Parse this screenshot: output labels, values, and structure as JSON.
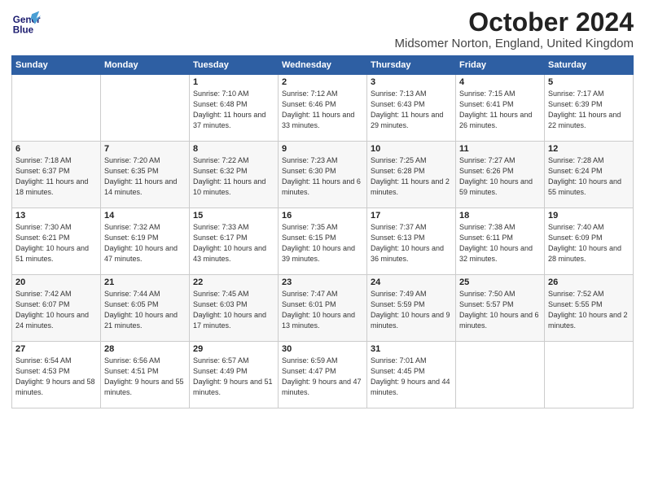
{
  "header": {
    "logo_line1": "General",
    "logo_line2": "Blue",
    "month_title": "October 2024",
    "location": "Midsomer Norton, England, United Kingdom"
  },
  "days_of_week": [
    "Sunday",
    "Monday",
    "Tuesday",
    "Wednesday",
    "Thursday",
    "Friday",
    "Saturday"
  ],
  "weeks": [
    [
      {
        "day": "",
        "sunrise": "",
        "sunset": "",
        "daylight": ""
      },
      {
        "day": "",
        "sunrise": "",
        "sunset": "",
        "daylight": ""
      },
      {
        "day": "1",
        "sunrise": "Sunrise: 7:10 AM",
        "sunset": "Sunset: 6:48 PM",
        "daylight": "Daylight: 11 hours and 37 minutes."
      },
      {
        "day": "2",
        "sunrise": "Sunrise: 7:12 AM",
        "sunset": "Sunset: 6:46 PM",
        "daylight": "Daylight: 11 hours and 33 minutes."
      },
      {
        "day": "3",
        "sunrise": "Sunrise: 7:13 AM",
        "sunset": "Sunset: 6:43 PM",
        "daylight": "Daylight: 11 hours and 29 minutes."
      },
      {
        "day": "4",
        "sunrise": "Sunrise: 7:15 AM",
        "sunset": "Sunset: 6:41 PM",
        "daylight": "Daylight: 11 hours and 26 minutes."
      },
      {
        "day": "5",
        "sunrise": "Sunrise: 7:17 AM",
        "sunset": "Sunset: 6:39 PM",
        "daylight": "Daylight: 11 hours and 22 minutes."
      }
    ],
    [
      {
        "day": "6",
        "sunrise": "Sunrise: 7:18 AM",
        "sunset": "Sunset: 6:37 PM",
        "daylight": "Daylight: 11 hours and 18 minutes."
      },
      {
        "day": "7",
        "sunrise": "Sunrise: 7:20 AM",
        "sunset": "Sunset: 6:35 PM",
        "daylight": "Daylight: 11 hours and 14 minutes."
      },
      {
        "day": "8",
        "sunrise": "Sunrise: 7:22 AM",
        "sunset": "Sunset: 6:32 PM",
        "daylight": "Daylight: 11 hours and 10 minutes."
      },
      {
        "day": "9",
        "sunrise": "Sunrise: 7:23 AM",
        "sunset": "Sunset: 6:30 PM",
        "daylight": "Daylight: 11 hours and 6 minutes."
      },
      {
        "day": "10",
        "sunrise": "Sunrise: 7:25 AM",
        "sunset": "Sunset: 6:28 PM",
        "daylight": "Daylight: 11 hours and 2 minutes."
      },
      {
        "day": "11",
        "sunrise": "Sunrise: 7:27 AM",
        "sunset": "Sunset: 6:26 PM",
        "daylight": "Daylight: 10 hours and 59 minutes."
      },
      {
        "day": "12",
        "sunrise": "Sunrise: 7:28 AM",
        "sunset": "Sunset: 6:24 PM",
        "daylight": "Daylight: 10 hours and 55 minutes."
      }
    ],
    [
      {
        "day": "13",
        "sunrise": "Sunrise: 7:30 AM",
        "sunset": "Sunset: 6:21 PM",
        "daylight": "Daylight: 10 hours and 51 minutes."
      },
      {
        "day": "14",
        "sunrise": "Sunrise: 7:32 AM",
        "sunset": "Sunset: 6:19 PM",
        "daylight": "Daylight: 10 hours and 47 minutes."
      },
      {
        "day": "15",
        "sunrise": "Sunrise: 7:33 AM",
        "sunset": "Sunset: 6:17 PM",
        "daylight": "Daylight: 10 hours and 43 minutes."
      },
      {
        "day": "16",
        "sunrise": "Sunrise: 7:35 AM",
        "sunset": "Sunset: 6:15 PM",
        "daylight": "Daylight: 10 hours and 39 minutes."
      },
      {
        "day": "17",
        "sunrise": "Sunrise: 7:37 AM",
        "sunset": "Sunset: 6:13 PM",
        "daylight": "Daylight: 10 hours and 36 minutes."
      },
      {
        "day": "18",
        "sunrise": "Sunrise: 7:38 AM",
        "sunset": "Sunset: 6:11 PM",
        "daylight": "Daylight: 10 hours and 32 minutes."
      },
      {
        "day": "19",
        "sunrise": "Sunrise: 7:40 AM",
        "sunset": "Sunset: 6:09 PM",
        "daylight": "Daylight: 10 hours and 28 minutes."
      }
    ],
    [
      {
        "day": "20",
        "sunrise": "Sunrise: 7:42 AM",
        "sunset": "Sunset: 6:07 PM",
        "daylight": "Daylight: 10 hours and 24 minutes."
      },
      {
        "day": "21",
        "sunrise": "Sunrise: 7:44 AM",
        "sunset": "Sunset: 6:05 PM",
        "daylight": "Daylight: 10 hours and 21 minutes."
      },
      {
        "day": "22",
        "sunrise": "Sunrise: 7:45 AM",
        "sunset": "Sunset: 6:03 PM",
        "daylight": "Daylight: 10 hours and 17 minutes."
      },
      {
        "day": "23",
        "sunrise": "Sunrise: 7:47 AM",
        "sunset": "Sunset: 6:01 PM",
        "daylight": "Daylight: 10 hours and 13 minutes."
      },
      {
        "day": "24",
        "sunrise": "Sunrise: 7:49 AM",
        "sunset": "Sunset: 5:59 PM",
        "daylight": "Daylight: 10 hours and 9 minutes."
      },
      {
        "day": "25",
        "sunrise": "Sunrise: 7:50 AM",
        "sunset": "Sunset: 5:57 PM",
        "daylight": "Daylight: 10 hours and 6 minutes."
      },
      {
        "day": "26",
        "sunrise": "Sunrise: 7:52 AM",
        "sunset": "Sunset: 5:55 PM",
        "daylight": "Daylight: 10 hours and 2 minutes."
      }
    ],
    [
      {
        "day": "27",
        "sunrise": "Sunrise: 6:54 AM",
        "sunset": "Sunset: 4:53 PM",
        "daylight": "Daylight: 9 hours and 58 minutes."
      },
      {
        "day": "28",
        "sunrise": "Sunrise: 6:56 AM",
        "sunset": "Sunset: 4:51 PM",
        "daylight": "Daylight: 9 hours and 55 minutes."
      },
      {
        "day": "29",
        "sunrise": "Sunrise: 6:57 AM",
        "sunset": "Sunset: 4:49 PM",
        "daylight": "Daylight: 9 hours and 51 minutes."
      },
      {
        "day": "30",
        "sunrise": "Sunrise: 6:59 AM",
        "sunset": "Sunset: 4:47 PM",
        "daylight": "Daylight: 9 hours and 47 minutes."
      },
      {
        "day": "31",
        "sunrise": "Sunrise: 7:01 AM",
        "sunset": "Sunset: 4:45 PM",
        "daylight": "Daylight: 9 hours and 44 minutes."
      },
      {
        "day": "",
        "sunrise": "",
        "sunset": "",
        "daylight": ""
      },
      {
        "day": "",
        "sunrise": "",
        "sunset": "",
        "daylight": ""
      }
    ]
  ]
}
